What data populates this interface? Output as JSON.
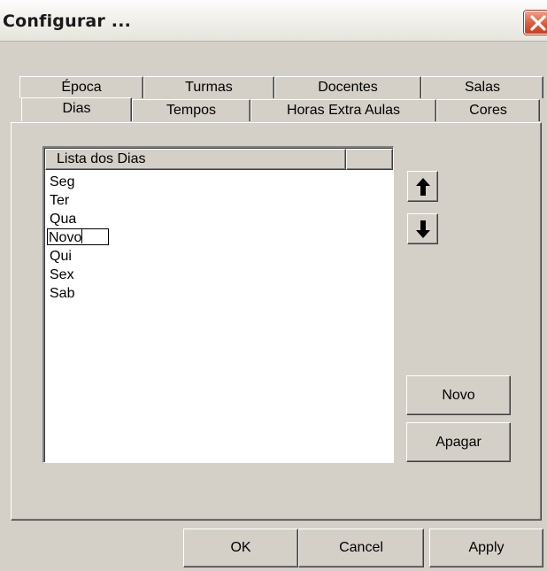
{
  "dialog": {
    "title": "Configurar ..."
  },
  "tabs": {
    "back_row": [
      "Época",
      "Turmas",
      "Docentes",
      "Salas"
    ],
    "front_row": [
      "Dias",
      "Tempos",
      "Horas Extra Aulas",
      "Cores"
    ],
    "selected": "Dias"
  },
  "list": {
    "column_header": "Lista dos Dias",
    "items": [
      "Seg",
      "Ter",
      "Qua",
      "Novo",
      "Qui",
      "Sex",
      "Sab"
    ],
    "editing_item": "Novo"
  },
  "icons": {
    "close": "close-icon",
    "move_up": "arrow-up-icon",
    "move_down": "arrow-down-icon"
  },
  "buttons": {
    "new": "Novo",
    "delete": "Apagar",
    "ok": "OK",
    "cancel": "Cancel",
    "apply": "Apply"
  },
  "colors": {
    "dialog_face": "#d4d0c8",
    "close_button": "#dd5a3c"
  }
}
